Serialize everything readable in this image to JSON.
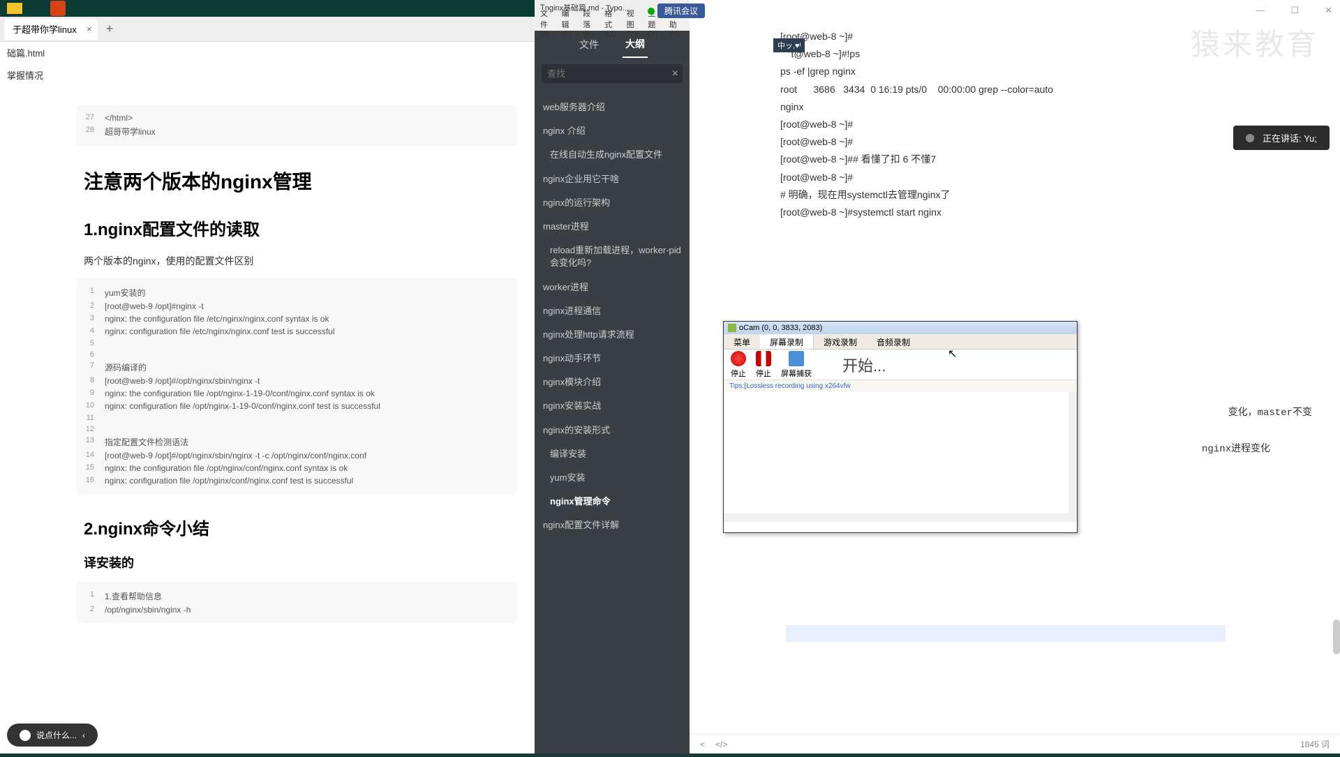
{
  "left": {
    "tab_title": "于超带你学linux",
    "url_text": "础篇.html",
    "bookmark": "掌握情况",
    "code_top": [
      {
        "n": "27",
        "t": "</html>"
      },
      {
        "n": "28",
        "t": "超哥带学linux"
      }
    ],
    "h1": "注意两个版本的nginx管理",
    "h2_1": "1.nginx配置文件的读取",
    "para1": "两个版本的nginx，使用的配置文件区别",
    "code_mid": [
      {
        "n": "1",
        "t": "yum安装的"
      },
      {
        "n": "2",
        "t": "[root@web-9 /opt]#nginx -t"
      },
      {
        "n": "3",
        "t": "nginx: the configuration file /etc/nginx/nginx.conf syntax is ok"
      },
      {
        "n": "4",
        "t": "nginx: configuration file /etc/nginx/nginx.conf test is successful"
      },
      {
        "n": "5",
        "t": ""
      },
      {
        "n": "6",
        "t": ""
      },
      {
        "n": "7",
        "t": "源码编译的"
      },
      {
        "n": "8",
        "t": "[root@web-9 /opt]#/opt/nginx/sbin/nginx -t"
      },
      {
        "n": "9",
        "t": "nginx: the configuration file /opt/nginx-1-19-0/conf/nginx.conf syntax is ok"
      },
      {
        "n": "10",
        "t": "nginx: configuration file /opt/nginx-1-19-0/conf/nginx.conf test is successful"
      },
      {
        "n": "11",
        "t": ""
      },
      {
        "n": "12",
        "t": ""
      },
      {
        "n": "13",
        "t": "指定配置文件检测语法"
      },
      {
        "n": "14",
        "t": "[root@web-9 /opt]#/opt/nginx/sbin/nginx -t -c /opt/nginx/conf/nginx.conf"
      },
      {
        "n": "15",
        "t": "nginx: the configuration file /opt/nginx/conf/nginx.conf syntax is ok"
      },
      {
        "n": "16",
        "t": "nginx: configuration file /opt/nginx/conf/nginx.conf test is successful"
      }
    ],
    "h2_2": "2.nginx命令小结",
    "h3_1": "译安装的",
    "code_bot": [
      {
        "n": "1",
        "t": "1.查看帮助信息"
      },
      {
        "n": "2",
        "t": "/opt/nginx/sbin/nginx -h"
      }
    ],
    "chat_label": "说点什么..."
  },
  "mid": {
    "typora_title": "nginx基础篇.md - Typo...",
    "menu": [
      "文件(F)",
      "编辑(E)",
      "段落(P)",
      "格式(O)",
      "视图(V)",
      "主题(T)",
      "帮助(H)"
    ],
    "tab_file": "文件",
    "tab_outline": "大纲",
    "search_placeholder": "查找",
    "outline": [
      {
        "t": "web服务器介绍",
        "i": 0
      },
      {
        "t": "nginx 介绍",
        "i": 0
      },
      {
        "t": "在线自动生成nginx配置文件",
        "i": 1
      },
      {
        "t": "nginx企业用它干啥",
        "i": 0
      },
      {
        "t": "nginx的运行架构",
        "i": 0
      },
      {
        "t": "master进程",
        "i": 0
      },
      {
        "t": "reload重新加载进程，worker-pid会变化吗?",
        "i": 1
      },
      {
        "t": "worker进程",
        "i": 0
      },
      {
        "t": "nginx进程通信",
        "i": 0
      },
      {
        "t": "nginx处理http请求流程",
        "i": 0
      },
      {
        "t": "nginx动手环节",
        "i": 0
      },
      {
        "t": "nginx模块介绍",
        "i": 0
      },
      {
        "t": "nginx安装实战",
        "i": 0
      },
      {
        "t": "nginx的安装形式",
        "i": 0
      },
      {
        "t": "编译安装",
        "i": 1
      },
      {
        "t": "yum安装",
        "i": 1
      },
      {
        "t": "nginx管理命令",
        "i": 1,
        "active": true
      },
      {
        "t": "nginx配置文件详解",
        "i": 0
      }
    ]
  },
  "right": {
    "conf_label": "腾讯会议",
    "watermark": "猿来教育",
    "ime": "中ッ,♥ᴵ",
    "terminal": [
      "[root@web-8 ~]#",
      "    t@web-8 ~]#!ps",
      "ps -ef |grep nginx",
      "root      3686   3434  0 16:19 pts/0    00:00:00 grep --color=auto",
      "nginx",
      "[root@web-8 ~]#",
      "[root@web-8 ~]#",
      "[root@web-8 ~]## 看懂了扣 6 不懂7",
      "[root@web-8 ~]#",
      "",
      "",
      "# 明确，现在用systemctl去管理nginx了",
      "[root@web-8 ~]#systemctl start nginx"
    ],
    "extra1": "变化，master不变",
    "extra2": "nginx进程变化",
    "speaking": "正在讲话: Yu;",
    "word_count": "1845 词",
    "nav_back": "<",
    "nav_code": "</>"
  },
  "ocam": {
    "title": "oCam (0, 0, 3833, 2083)",
    "tabs": [
      "菜单",
      "屏幕录制",
      "游戏录制",
      "音频录制"
    ],
    "btn_stop": "停止",
    "btn_pause": "停止",
    "btn_capture": "屏幕捕获",
    "start_text": "开始...",
    "status": "Tips:[Lossless recording using x264vfw"
  }
}
